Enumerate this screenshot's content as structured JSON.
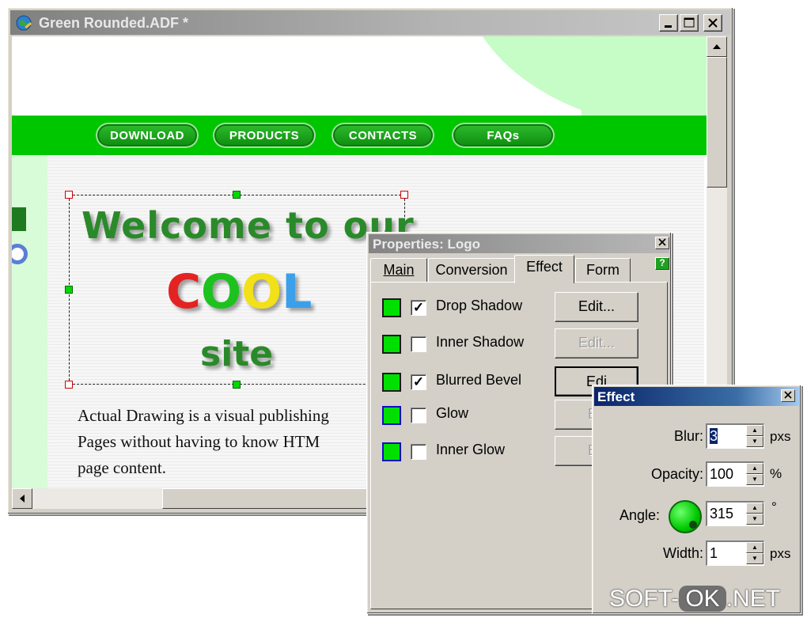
{
  "window": {
    "title": "Green Rounded.ADF *"
  },
  "site": {
    "nav": [
      "DOWNLOAD",
      "PRODUCTS",
      "CONTACTS",
      "FAQs"
    ],
    "logo": {
      "line1": "Welcome to our",
      "cool": [
        "C",
        "O",
        "O",
        "L"
      ],
      "line3": "site"
    },
    "body_text": [
      "Actual Drawing is a visual publishing",
      "Pages without having to know HTM",
      "page content."
    ]
  },
  "properties": {
    "title": "Properties: Logo",
    "tabs": [
      "Main",
      "Conversion",
      "Effect",
      "Form"
    ],
    "active_tab": "Effect",
    "edit_label": "Edit...",
    "edit_partial": "Edi",
    "edit_partial_short": "Ed",
    "effects": [
      {
        "label": "Drop Shadow",
        "checked": true,
        "swatch": "#00e000",
        "swatch_border": "#1a1a1a"
      },
      {
        "label": "Inner Shadow",
        "checked": false,
        "swatch": "#00e000",
        "swatch_border": "#1a1a1a"
      },
      {
        "label": "Blurred Bevel",
        "checked": true,
        "swatch": "#00e000",
        "swatch_border": "#1a1a1a"
      },
      {
        "label": "Glow",
        "checked": false,
        "swatch": "#00e000",
        "swatch_border": "#1010c0"
      },
      {
        "label": "Inner Glow",
        "checked": false,
        "swatch": "#00e000",
        "swatch_border": "#1010c0"
      }
    ]
  },
  "effect_dialog": {
    "title": "Effect",
    "blur": {
      "label": "Blur:",
      "value": "3",
      "unit": "pxs"
    },
    "opacity": {
      "label": "Opacity:",
      "value": "100",
      "unit": "%"
    },
    "angle": {
      "label": "Angle:",
      "value": "315",
      "unit": "°"
    },
    "width": {
      "label": "Width:",
      "value": "1",
      "unit": "pxs"
    }
  },
  "watermark": {
    "left": "SOFT-",
    "ok": "OK",
    "right": ".NET"
  },
  "colors": {
    "nav_green": "#00c600",
    "hero_mint": "#c6fcc6",
    "dialog_bg": "#d4d0c8",
    "active_title": "#0a246a"
  }
}
